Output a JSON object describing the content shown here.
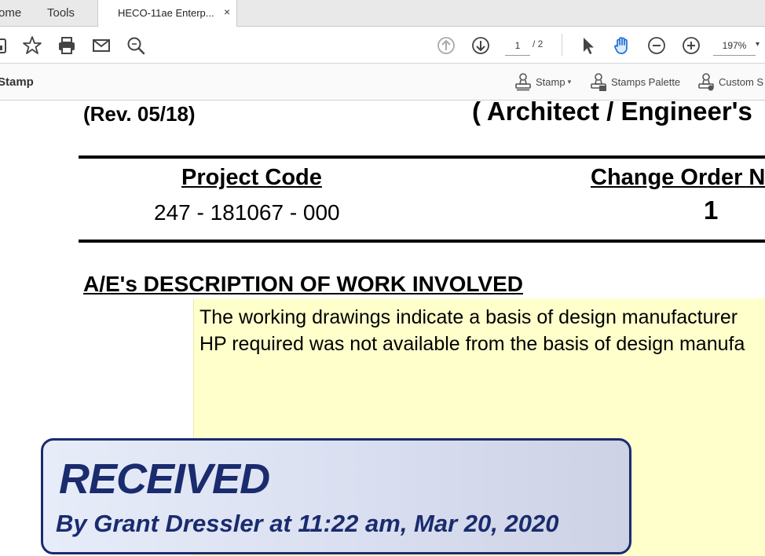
{
  "tabs": {
    "home": "ome",
    "tools": "Tools",
    "document": "HECO-11ae Enterp...",
    "close_glyph": "×"
  },
  "toolbar": {
    "page_current": "1",
    "page_total": "/ 2",
    "zoom": "197%",
    "zoom_caret": "▾"
  },
  "stamp_toolbar": {
    "title": "Stamp",
    "stamp_label": "Stamp",
    "stamps_palette_label": "Stamps Palette",
    "custom_stamps_label": "Custom S",
    "caret": "▾"
  },
  "document": {
    "revision": "(Rev. 05/18)",
    "architect_heading": "( Architect / Engineer's",
    "project_code_label": "Project Code",
    "project_code_value": "247 - 181067 - 000",
    "change_order_label": "Change Order N",
    "change_order_value": "1",
    "description_heading": "A/E's DESCRIPTION OF WORK INVOLVED",
    "note_line_1": "The working drawings indicate a basis of design manufacturer",
    "note_line_2": "HP required was not available from the basis of design manufa"
  },
  "stamp": {
    "title": "RECEIVED",
    "subtitle": "By Grant Dressler at 11:22 am, Mar 20, 2020",
    "color": "#1a2b6e"
  },
  "colors": {
    "accent_blue": "#1e6fd9",
    "note_yellow": "#ffffcc"
  }
}
